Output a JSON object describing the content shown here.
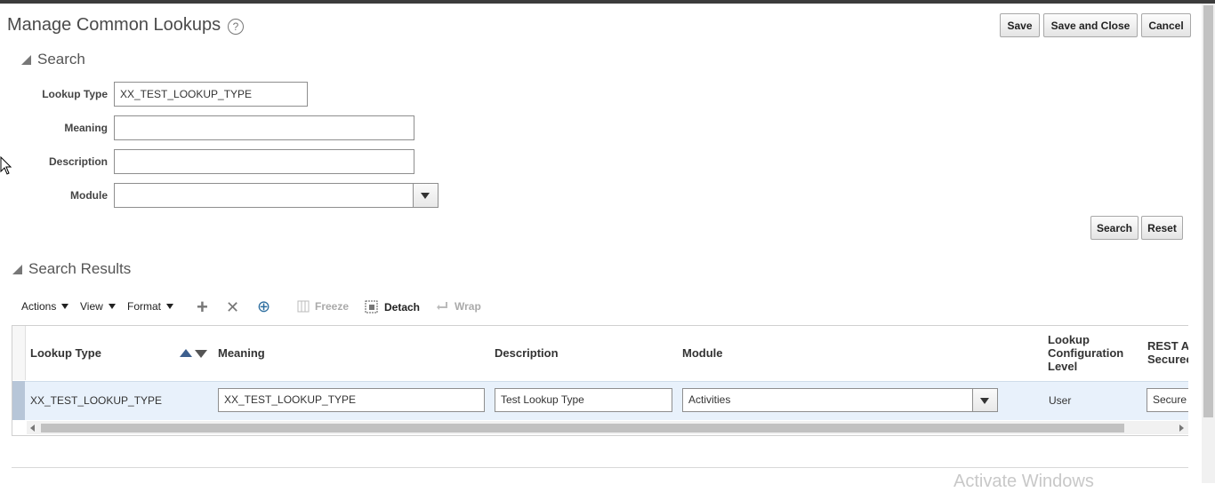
{
  "page": {
    "title": "Manage Common Lookups",
    "help_icon": "?"
  },
  "header_buttons": {
    "save": "Save",
    "save_and_close": "Save and Close",
    "cancel": "Cancel"
  },
  "search": {
    "heading": "Search",
    "fields": {
      "lookup_type": {
        "label": "Lookup Type",
        "value": "XX_TEST_LOOKUP_TYPE"
      },
      "meaning": {
        "label": "Meaning",
        "value": ""
      },
      "description": {
        "label": "Description",
        "value": ""
      },
      "module": {
        "label": "Module",
        "value": ""
      }
    },
    "buttons": {
      "search": "Search",
      "reset": "Reset"
    }
  },
  "results": {
    "heading": "Search Results",
    "toolbar": {
      "actions": "Actions",
      "view": "View",
      "format": "Format",
      "add_icon": "+",
      "delete_icon": "✕",
      "refresh_icon": "⊕",
      "freeze": "Freeze",
      "detach": "Detach",
      "wrap": "Wrap"
    },
    "columns": {
      "lookup_type": "Lookup Type",
      "meaning": "Meaning",
      "description": "Description",
      "module": "Module",
      "config_level": [
        "Lookup",
        "Configuration",
        "Level"
      ],
      "rest_secured": [
        "REST A",
        "Securec"
      ]
    },
    "rows": [
      {
        "lookup_type": "XX_TEST_LOOKUP_TYPE",
        "meaning": "XX_TEST_LOOKUP_TYPE",
        "description": "Test Lookup Type",
        "module": "Activities",
        "config_level": "User",
        "rest_secured": "Secure"
      }
    ]
  },
  "watermark": "Activate Windows"
}
